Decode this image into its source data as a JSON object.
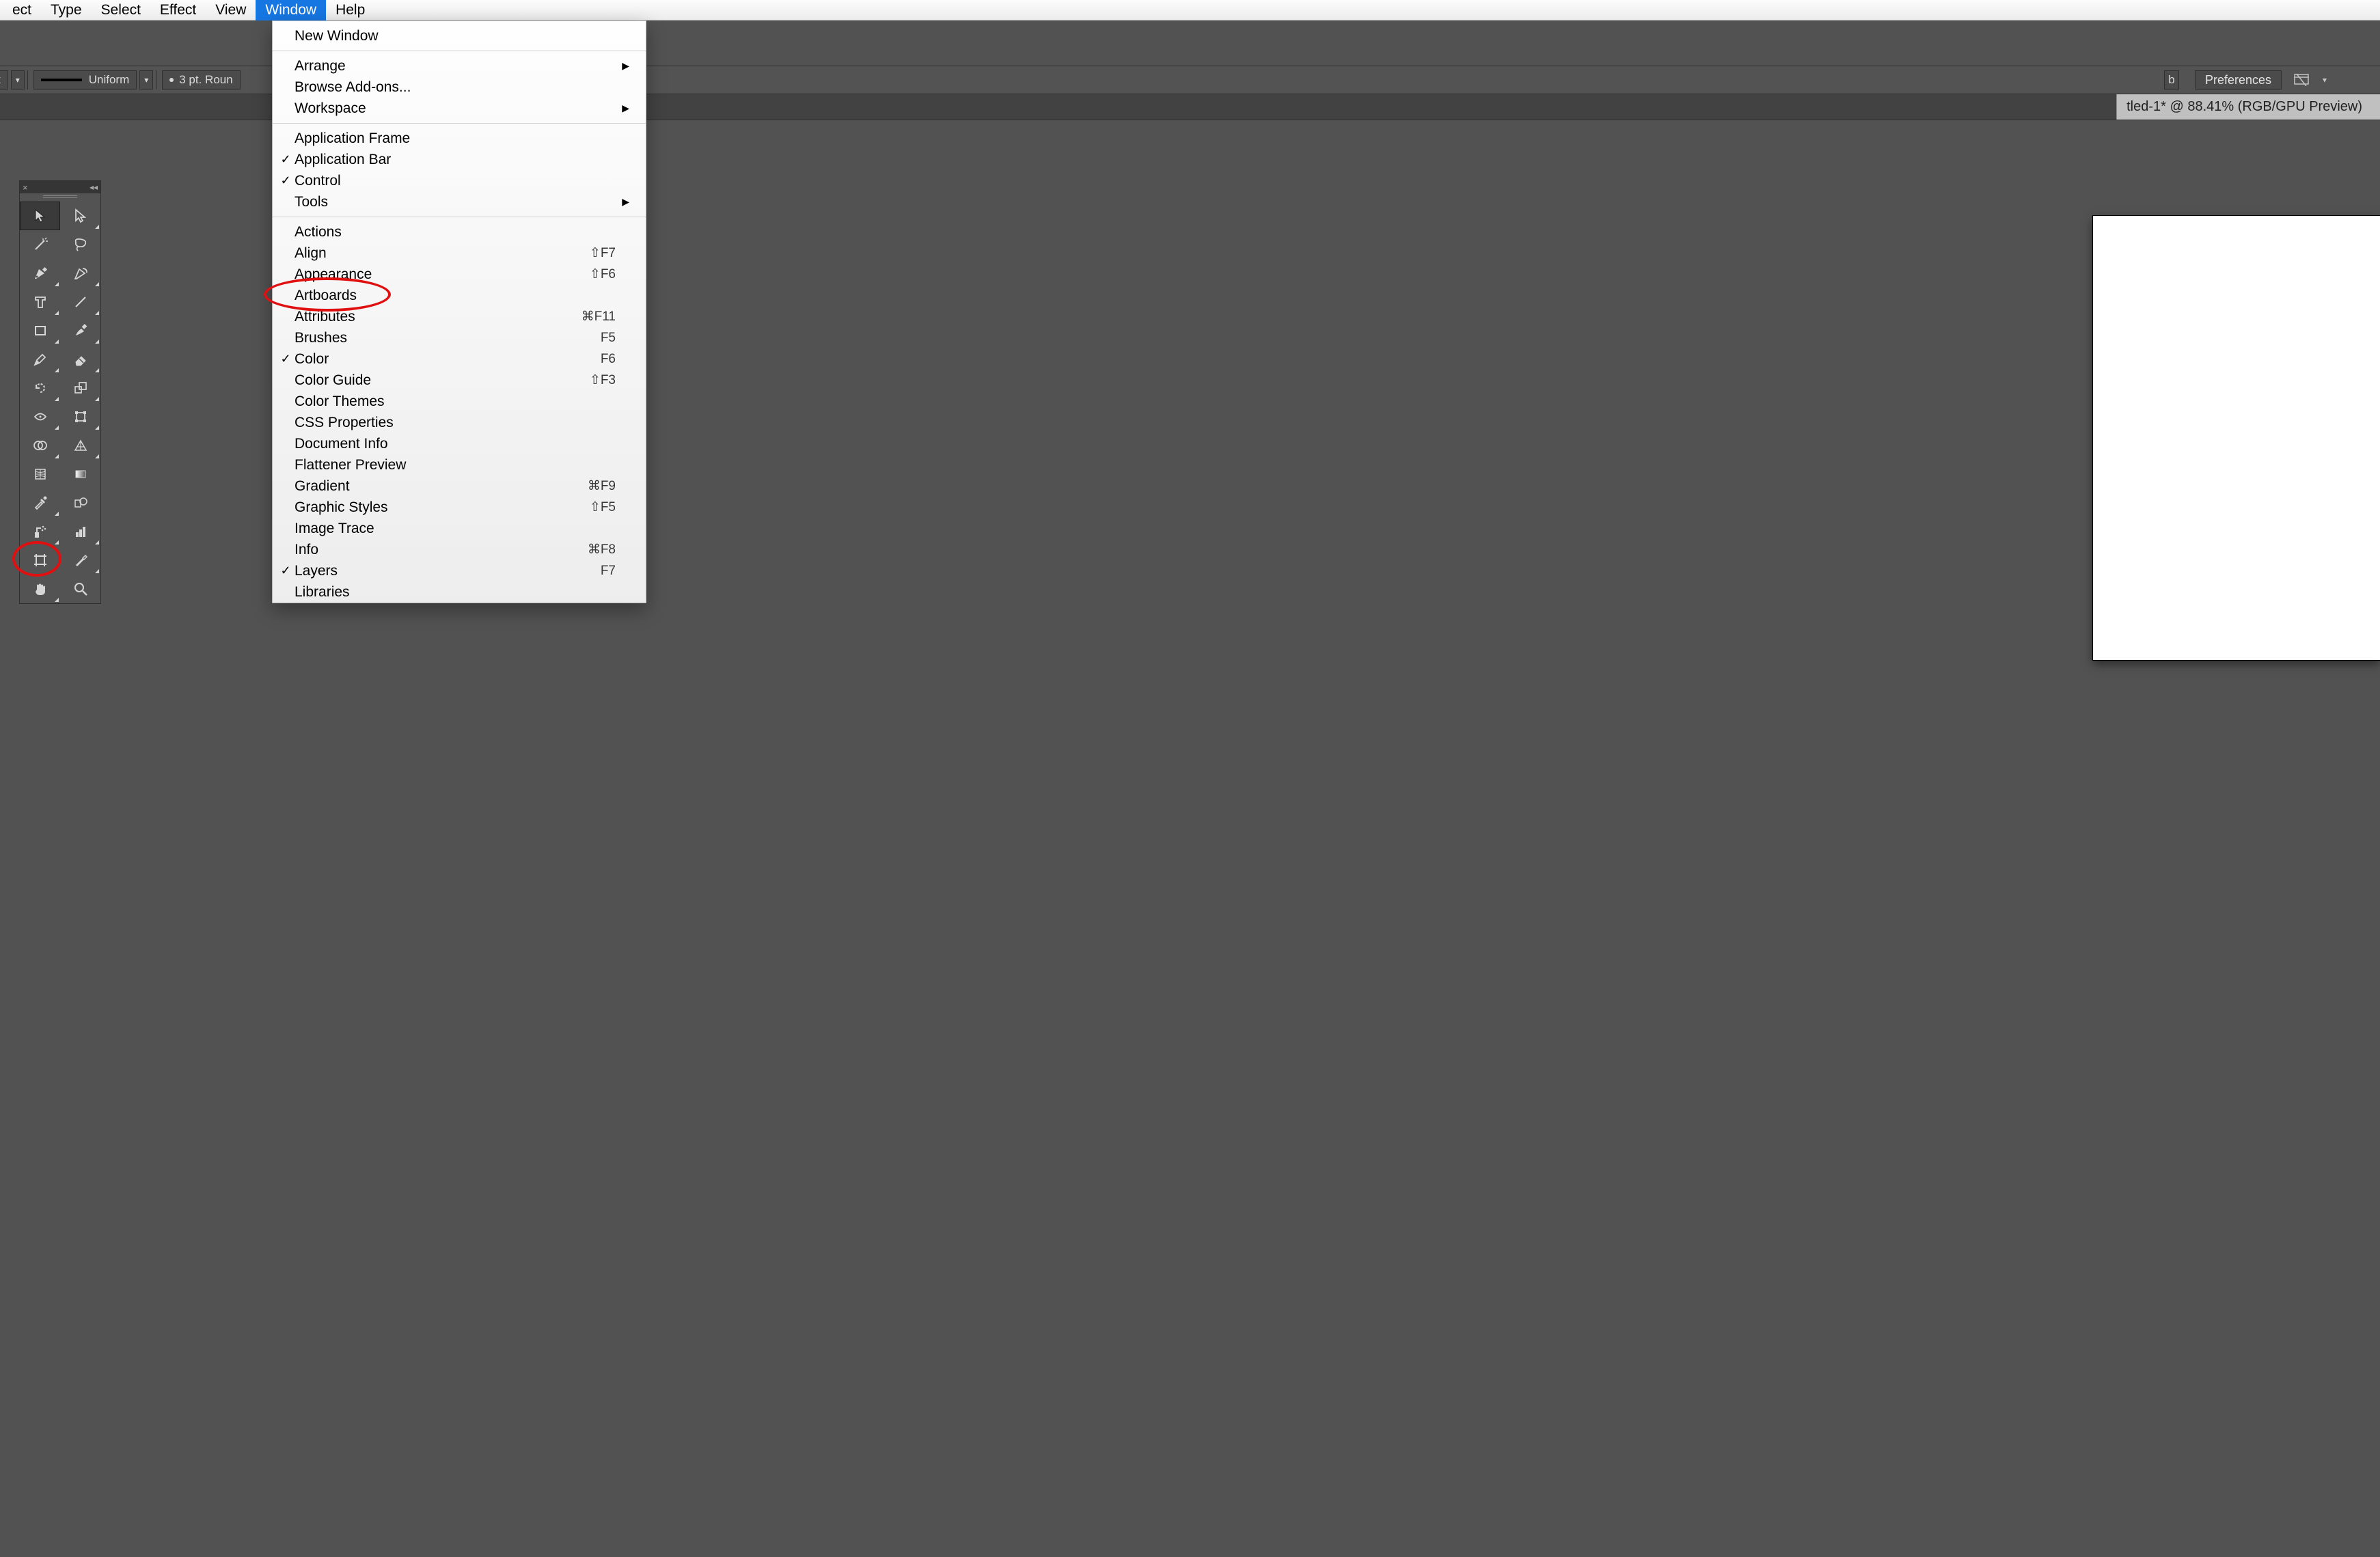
{
  "menubar": {
    "items": [
      {
        "label": "ect"
      },
      {
        "label": "Type"
      },
      {
        "label": "Select"
      },
      {
        "label": "Effect"
      },
      {
        "label": "View"
      },
      {
        "label": "Window",
        "highlighted": true
      },
      {
        "label": "Help"
      }
    ]
  },
  "control_bar": {
    "left_truncated": "t",
    "stroke_style": "Uniform",
    "brush_preset": "3 pt. Roun",
    "right_truncated": "b",
    "preferences_label": "Preferences"
  },
  "document_tab": {
    "label": "tled-1* @ 88.41% (RGB/GPU Preview)"
  },
  "window_menu": {
    "sections": [
      {
        "items": [
          {
            "label": "New Window",
            "check": false,
            "submenu": false,
            "shortcut": ""
          }
        ]
      },
      {
        "items": [
          {
            "label": "Arrange",
            "check": false,
            "submenu": true,
            "shortcut": ""
          },
          {
            "label": "Browse Add-ons...",
            "check": false,
            "submenu": false,
            "shortcut": ""
          },
          {
            "label": "Workspace",
            "check": false,
            "submenu": true,
            "shortcut": ""
          }
        ]
      },
      {
        "items": [
          {
            "label": "Application Frame",
            "check": false,
            "submenu": false,
            "shortcut": ""
          },
          {
            "label": "Application Bar",
            "check": true,
            "submenu": false,
            "shortcut": ""
          },
          {
            "label": "Control",
            "check": true,
            "submenu": false,
            "shortcut": ""
          },
          {
            "label": "Tools",
            "check": false,
            "submenu": true,
            "shortcut": ""
          }
        ]
      },
      {
        "items": [
          {
            "label": "Actions",
            "check": false,
            "submenu": false,
            "shortcut": ""
          },
          {
            "label": "Align",
            "check": false,
            "submenu": false,
            "shortcut": "⇧F7"
          },
          {
            "label": "Appearance",
            "check": false,
            "submenu": false,
            "shortcut": "⇧F6"
          },
          {
            "label": "Artboards",
            "check": false,
            "submenu": false,
            "shortcut": ""
          },
          {
            "label": "Attributes",
            "check": false,
            "submenu": false,
            "shortcut": "⌘F11"
          },
          {
            "label": "Brushes",
            "check": false,
            "submenu": false,
            "shortcut": "F5"
          },
          {
            "label": "Color",
            "check": true,
            "submenu": false,
            "shortcut": "F6"
          },
          {
            "label": "Color Guide",
            "check": false,
            "submenu": false,
            "shortcut": "⇧F3"
          },
          {
            "label": "Color Themes",
            "check": false,
            "submenu": false,
            "shortcut": ""
          },
          {
            "label": "CSS Properties",
            "check": false,
            "submenu": false,
            "shortcut": ""
          },
          {
            "label": "Document Info",
            "check": false,
            "submenu": false,
            "shortcut": ""
          },
          {
            "label": "Flattener Preview",
            "check": false,
            "submenu": false,
            "shortcut": ""
          },
          {
            "label": "Gradient",
            "check": false,
            "submenu": false,
            "shortcut": "⌘F9"
          },
          {
            "label": "Graphic Styles",
            "check": false,
            "submenu": false,
            "shortcut": "⇧F5"
          },
          {
            "label": "Image Trace",
            "check": false,
            "submenu": false,
            "shortcut": ""
          },
          {
            "label": "Info",
            "check": false,
            "submenu": false,
            "shortcut": "⌘F8"
          },
          {
            "label": "Layers",
            "check": true,
            "submenu": false,
            "shortcut": "F7"
          },
          {
            "label": "Libraries",
            "check": false,
            "submenu": false,
            "shortcut": ""
          }
        ]
      }
    ]
  },
  "tools": [
    {
      "name": "selection-tool",
      "selected": true,
      "flyout": false
    },
    {
      "name": "direct-selection-tool",
      "selected": false,
      "flyout": true
    },
    {
      "name": "magic-wand-tool",
      "selected": false,
      "flyout": false
    },
    {
      "name": "lasso-tool",
      "selected": false,
      "flyout": false
    },
    {
      "name": "pen-tool",
      "selected": false,
      "flyout": true
    },
    {
      "name": "curvature-tool",
      "selected": false,
      "flyout": true
    },
    {
      "name": "type-tool",
      "selected": false,
      "flyout": true
    },
    {
      "name": "line-segment-tool",
      "selected": false,
      "flyout": true
    },
    {
      "name": "rectangle-tool",
      "selected": false,
      "flyout": true
    },
    {
      "name": "paintbrush-tool",
      "selected": false,
      "flyout": true
    },
    {
      "name": "pencil-tool",
      "selected": false,
      "flyout": true
    },
    {
      "name": "eraser-tool",
      "selected": false,
      "flyout": true
    },
    {
      "name": "rotate-tool",
      "selected": false,
      "flyout": true
    },
    {
      "name": "scale-tool",
      "selected": false,
      "flyout": true
    },
    {
      "name": "width-tool",
      "selected": false,
      "flyout": true
    },
    {
      "name": "free-transform-tool",
      "selected": false,
      "flyout": true
    },
    {
      "name": "shape-builder-tool",
      "selected": false,
      "flyout": true
    },
    {
      "name": "perspective-grid-tool",
      "selected": false,
      "flyout": true
    },
    {
      "name": "mesh-tool",
      "selected": false,
      "flyout": false
    },
    {
      "name": "gradient-tool",
      "selected": false,
      "flyout": false
    },
    {
      "name": "eyedropper-tool",
      "selected": false,
      "flyout": true
    },
    {
      "name": "blend-tool",
      "selected": false,
      "flyout": false
    },
    {
      "name": "symbol-sprayer-tool",
      "selected": false,
      "flyout": true
    },
    {
      "name": "column-graph-tool",
      "selected": false,
      "flyout": true
    },
    {
      "name": "artboard-tool",
      "selected": false,
      "flyout": false
    },
    {
      "name": "slice-tool",
      "selected": false,
      "flyout": true
    },
    {
      "name": "hand-tool",
      "selected": false,
      "flyout": true
    },
    {
      "name": "zoom-tool",
      "selected": false,
      "flyout": false
    }
  ],
  "annotations": {
    "artboards_circle": true,
    "artboard_tool_circle": true
  }
}
